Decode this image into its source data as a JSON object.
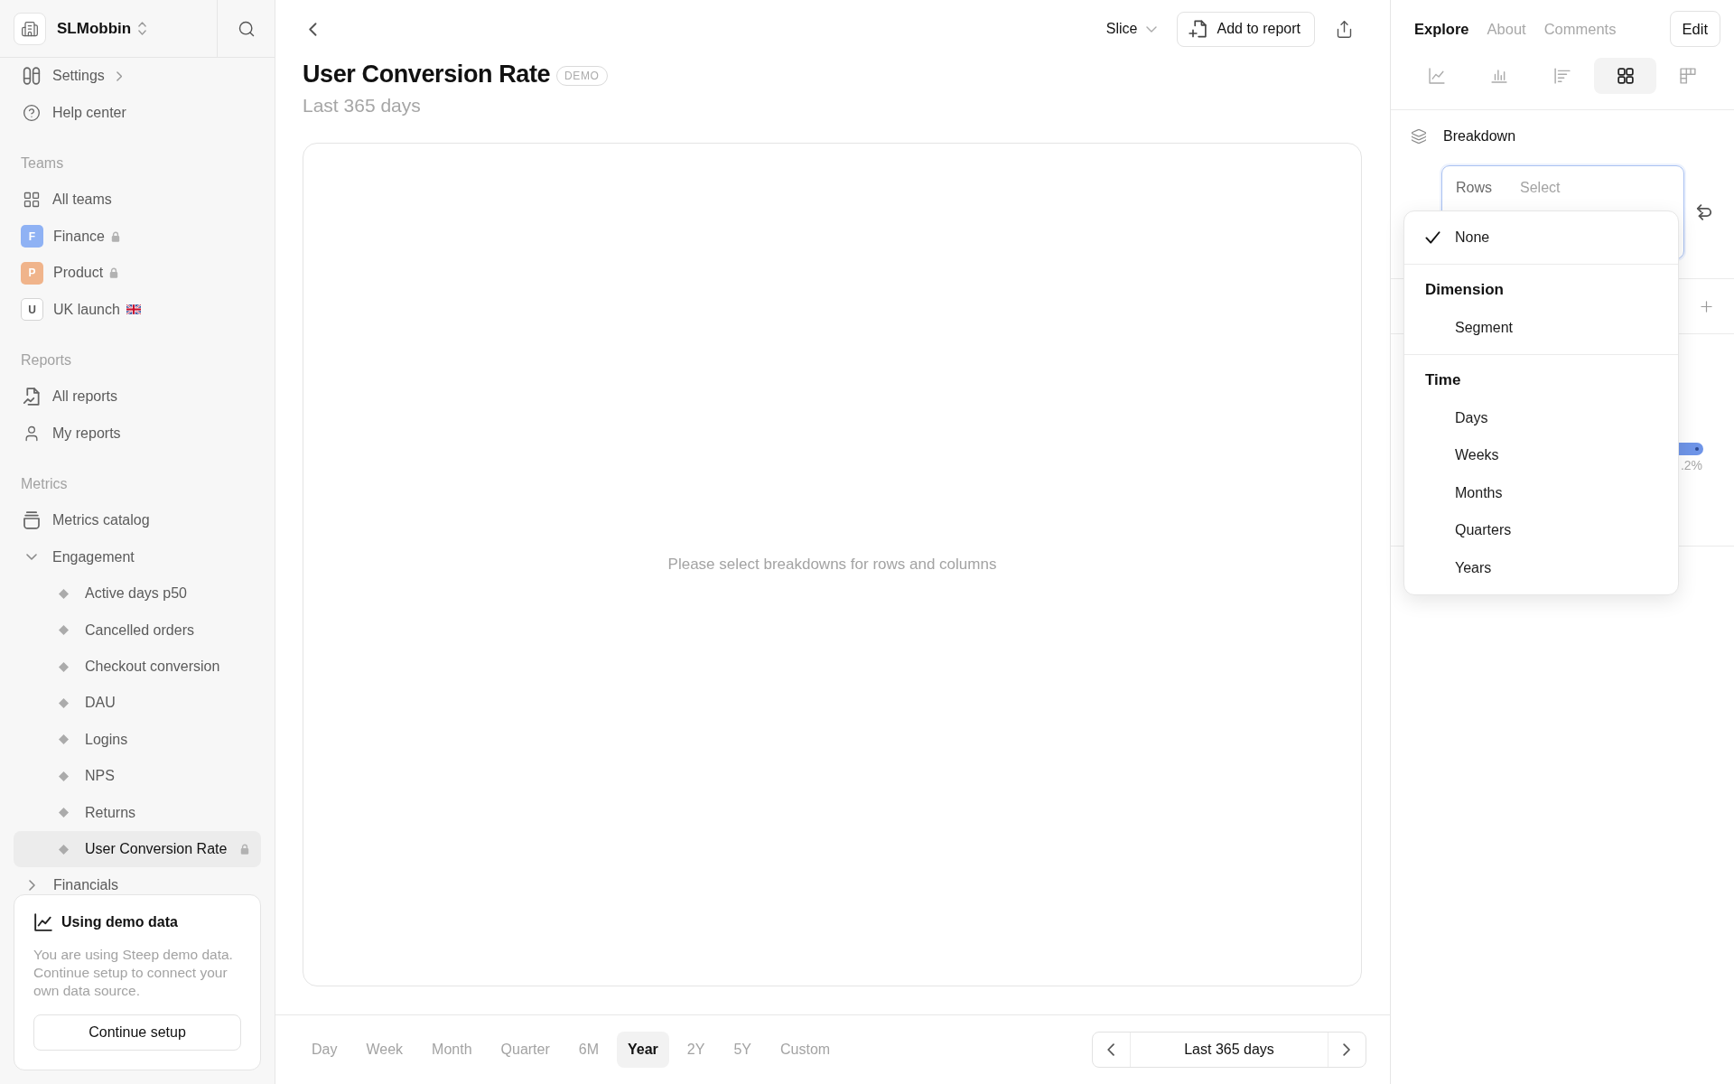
{
  "sidebar": {
    "workspace": {
      "name": "SLMobbin"
    },
    "links": [
      {
        "kind": "settings",
        "label": "Settings"
      },
      {
        "kind": "help",
        "label": "Help center"
      }
    ],
    "teams": {
      "heading": "Teams",
      "overview": "All teams",
      "items": [
        {
          "kind": "filled",
          "initial": "F",
          "label": "Finance",
          "color": "#8fb2f4",
          "locked": true,
          "flag": false
        },
        {
          "kind": "filled",
          "initial": "P",
          "label": "Product",
          "color": "#f0b48b",
          "locked": true,
          "flag": false
        },
        {
          "kind": "outlined",
          "initial": "U",
          "label": "UK launch",
          "color": "#ffffff",
          "locked": false,
          "flag": true
        }
      ]
    },
    "reports": {
      "heading": "Reports",
      "items": [
        {
          "kind": "all",
          "label": "All reports"
        },
        {
          "kind": "mine",
          "label": "My reports"
        }
      ]
    },
    "metrics": {
      "heading": "Metrics",
      "catalog": "Metrics catalog",
      "folders": [
        {
          "label": "Engagement",
          "expanded": true,
          "children": [
            {
              "label": "Active days p50",
              "selected": false,
              "locked": false
            },
            {
              "label": "Cancelled orders",
              "selected": false,
              "locked": false
            },
            {
              "label": "Checkout conversion",
              "selected": false,
              "locked": false
            },
            {
              "label": "DAU",
              "selected": false,
              "locked": false
            },
            {
              "label": "Logins",
              "selected": false,
              "locked": false
            },
            {
              "label": "NPS",
              "selected": false,
              "locked": false
            },
            {
              "label": "Returns",
              "selected": false,
              "locked": false
            },
            {
              "label": "User Conversion Rate",
              "selected": true,
              "locked": true
            }
          ]
        },
        {
          "label": "Financials",
          "expanded": false
        }
      ]
    },
    "demo_card": {
      "title": "Using demo data",
      "text": "You are using Steep demo data. Continue setup to connect your own data source.",
      "button": "Continue setup"
    }
  },
  "toolbar": {
    "slice": "Slice",
    "add_to_report": "Add to report"
  },
  "report": {
    "title": "User Conversion Rate",
    "tag": "DEMO",
    "subtitle": "Last 365 days",
    "empty_message": "Please select breakdowns for rows and columns"
  },
  "time_ranges": [
    {
      "label": "Day",
      "selected": false
    },
    {
      "label": "Week",
      "selected": false
    },
    {
      "label": "Month",
      "selected": false
    },
    {
      "label": "Quarter",
      "selected": false
    },
    {
      "label": "6M",
      "selected": false
    },
    {
      "label": "Year",
      "selected": true
    },
    {
      "label": "2Y",
      "selected": false
    },
    {
      "label": "5Y",
      "selected": false
    },
    {
      "label": "Custom",
      "selected": false
    }
  ],
  "date_navigator": {
    "label": "Last 365 days"
  },
  "panel": {
    "tabs": [
      {
        "label": "Explore",
        "selected": true
      },
      {
        "label": "About",
        "selected": false
      },
      {
        "label": "Comments",
        "selected": false
      }
    ],
    "edit_button": "Edit",
    "view_types": [
      {
        "kind": "line",
        "selected": false
      },
      {
        "kind": "column",
        "selected": false
      },
      {
        "kind": "bar",
        "selected": false
      },
      {
        "kind": "grid",
        "selected": true
      },
      {
        "kind": "pivot",
        "selected": false
      }
    ],
    "breakdown": {
      "title": "Breakdown",
      "rows_label": "Rows",
      "placeholder": "Select"
    },
    "partial_reading": ".2%",
    "menu": {
      "sections": [
        {
          "options": [
            {
              "label": "None",
              "selected": true
            }
          ]
        },
        {
          "heading": "Dimension",
          "options": [
            {
              "label": "Segment",
              "selected": false
            }
          ]
        },
        {
          "heading": "Time",
          "options": [
            {
              "label": "Days",
              "selected": false
            },
            {
              "label": "Weeks",
              "selected": false
            },
            {
              "label": "Months",
              "selected": false
            },
            {
              "label": "Quarters",
              "selected": false
            },
            {
              "label": "Years",
              "selected": false
            }
          ]
        }
      ]
    }
  }
}
